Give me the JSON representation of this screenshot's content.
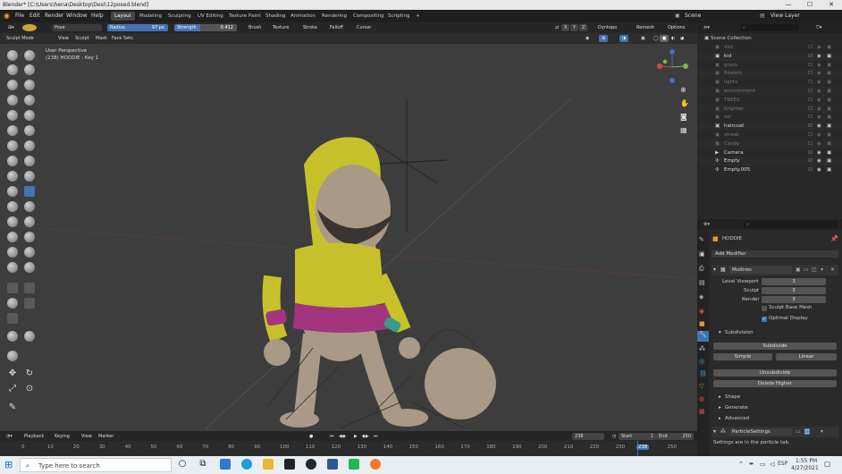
{
  "window": {
    "title": "Blender* [C:\\Users\\hena\\Desktop\\Desi\\12posed.blend]"
  },
  "menu": {
    "items": [
      "File",
      "Edit",
      "Render",
      "Window",
      "Help"
    ],
    "workspaces": [
      "Layout",
      "Modeling",
      "Sculpting",
      "UV Editing",
      "Texture Paint",
      "Shading",
      "Animation",
      "Rendering",
      "Compositing",
      "Scripting"
    ],
    "add_tab": "+",
    "scene_label": "Scene",
    "view_layer_label": "View Layer"
  },
  "tool_header": {
    "brush_name": "Pose",
    "radius_label": "Radius",
    "radius_value": "97 px",
    "strength_label": "Strength",
    "strength_value": "0.412",
    "menus": [
      "Brush",
      "Texture",
      "Stroke",
      "Falloff",
      "Cursor"
    ],
    "axes": [
      "X",
      "Y",
      "Z"
    ],
    "dyntopo": "Dyntopo",
    "remesh": "Remesh",
    "options": "Options"
  },
  "header2": {
    "mode": "Sculpt Mode",
    "menus": [
      "View",
      "Sculpt",
      "Mask",
      "Face Sets"
    ]
  },
  "viewport": {
    "perspective": "User Perspective",
    "object_info": "(238) HODDIE : Key 1"
  },
  "timeline": {
    "menus": [
      "Playback",
      "Keying",
      "View",
      "Marker"
    ],
    "current_frame": "238",
    "start_label": "Start",
    "start_value": "1",
    "end_label": "End",
    "end_value": "250",
    "ticks": [
      "0",
      "10",
      "20",
      "30",
      "40",
      "50",
      "60",
      "70",
      "80",
      "90",
      "100",
      "110",
      "120",
      "130",
      "140",
      "150",
      "160",
      "170",
      "180",
      "190",
      "200",
      "210",
      "220",
      "230",
      "238",
      "250"
    ]
  },
  "outliner": {
    "title": "Scene Collection",
    "items": [
      {
        "name": "dist",
        "dim": true
      },
      {
        "name": "kid",
        "dim": false
      },
      {
        "name": "grass",
        "dim": true
      },
      {
        "name": "flowers",
        "dim": true
      },
      {
        "name": "lights",
        "dim": true
      },
      {
        "name": "environment",
        "dim": true
      },
      {
        "name": "TREES",
        "dim": true
      },
      {
        "name": "brighter",
        "dim": true
      },
      {
        "name": "sol",
        "dim": true
      },
      {
        "name": "haircoat",
        "dim": false
      },
      {
        "name": "streak",
        "dim": true
      },
      {
        "name": "Candy",
        "dim": true
      },
      {
        "name": "Camera",
        "dim": false
      },
      {
        "name": "Empty",
        "dim": false
      },
      {
        "name": "Empty.005",
        "dim": false
      }
    ]
  },
  "properties": {
    "object_name": "HODDIE",
    "add_modifier": "Add Modifier",
    "modifier_name": "Multires",
    "levels": [
      {
        "label": "Level Viewport",
        "value": "3"
      },
      {
        "label": "Sculpt",
        "value": "3"
      },
      {
        "label": "Render",
        "value": "3"
      }
    ],
    "sculpt_base_mesh": "Sculpt Base Mesh",
    "optimal_display": "Optimal Display",
    "subdivision_label": "Subdivision",
    "subdivide": "Subdivide",
    "simple": "Simple",
    "linear": "Linear",
    "unsubdivide": "Unsubdivide",
    "delete_higher": "Delete Higher",
    "sections": [
      "Shape",
      "Generate",
      "Advanced"
    ],
    "particle_settings": "ParticleSettings",
    "particle_note": "Settings are in the particle tab."
  },
  "taskbar": {
    "search_placeholder": "Type here to search",
    "lang": "ESP",
    "time": "1:55 PM",
    "date": "4/27/2021"
  },
  "colors": {
    "accent_blue": "#4772b3",
    "active_orange": "#e59a3c",
    "hoodie_yellow": "#c6c12a",
    "shorts_magenta": "#a3347e",
    "skin": "#a89a87"
  }
}
